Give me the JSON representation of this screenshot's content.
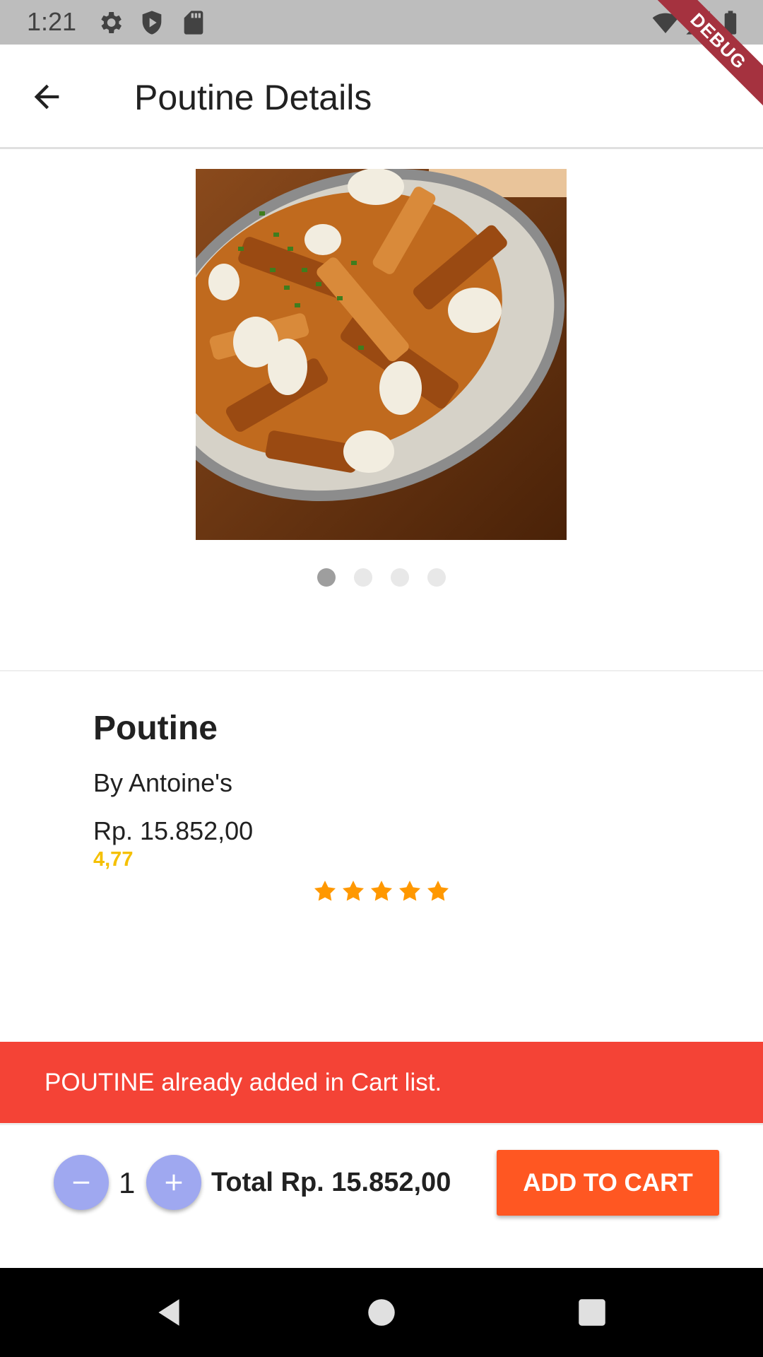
{
  "status_bar": {
    "time": "1:21",
    "icons_left": [
      "gear-icon",
      "shield-icon",
      "sd-card-icon"
    ],
    "icons_right": [
      "wifi-icon",
      "signal-icon",
      "battery-icon"
    ]
  },
  "debug_banner": "DEBUG",
  "app_bar": {
    "title": "Poutine Details",
    "back_icon": "arrow-back-icon"
  },
  "carousel": {
    "image_description": "poutine-dish-photo",
    "page_count": 4,
    "active_index": 0
  },
  "product": {
    "name": "Poutine",
    "vendor": "By Antoine's",
    "price": "Rp. 15.852,00",
    "rating_label": "4,77",
    "rating": 4.77,
    "max_rating": 5,
    "star_color": "#ff9800",
    "rating_text_color": "#f5c000"
  },
  "snackbar": {
    "message": "POUTINE already added in Cart list.",
    "color": "#f44336"
  },
  "cart_bar": {
    "quantity": "1",
    "total": "Total Rp. 15.852,00",
    "add_button_label": "ADD TO CART",
    "add_button_color": "#ff5722",
    "qty_button_color": "#9fa8f0"
  },
  "nav_bar": {
    "buttons": [
      "back-triangle-icon",
      "home-circle-icon",
      "recents-square-icon"
    ]
  }
}
